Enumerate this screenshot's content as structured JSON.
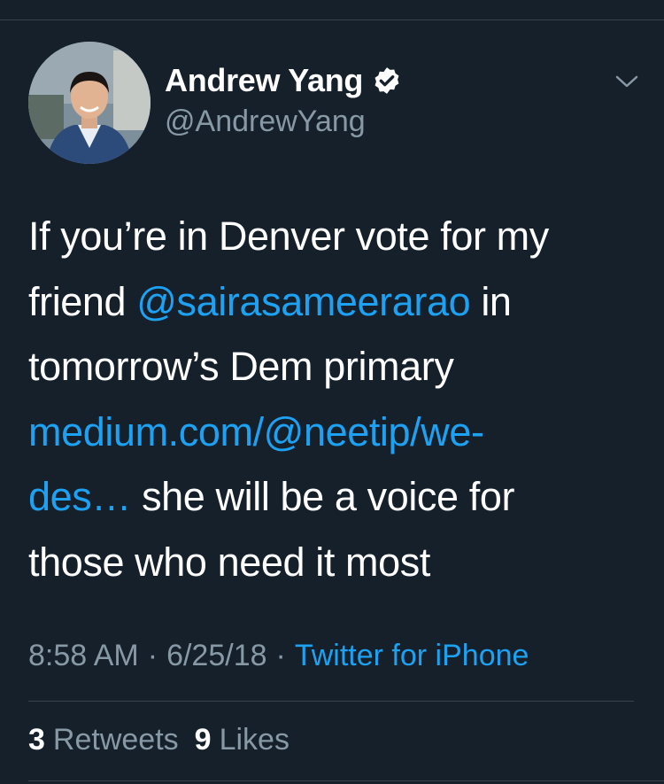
{
  "author": {
    "display_name": "Andrew Yang",
    "handle": "@AndrewYang",
    "verified_icon": "verified-badge-icon",
    "avatar_icon": "profile-photo"
  },
  "menu": {
    "icon": "chevron-down-icon"
  },
  "tweet": {
    "line1": "If you’re in Denver vote for my",
    "line2_pre": "friend ",
    "line2_mention": "@sairasameerarao",
    "line2_post": " in",
    "line3": "tomorrow’s Dem primary",
    "line4_link": "medium.com/@neetip/we-",
    "line5_link": "des…",
    "line5_post": " she will be a voice for",
    "line6": "those who need it most"
  },
  "meta": {
    "time": "8:58 AM",
    "separator": "·",
    "date": "6/25/18",
    "source": "Twitter for iPhone"
  },
  "stats": {
    "retweets_count": "3",
    "retweets_label": "Retweets",
    "likes_count": "9",
    "likes_label": "Likes"
  },
  "colors": {
    "background": "#15202b",
    "primary_text": "#ffffff",
    "secondary_text": "#8899a6",
    "link": "#1da1f2",
    "divider": "#38444d"
  }
}
